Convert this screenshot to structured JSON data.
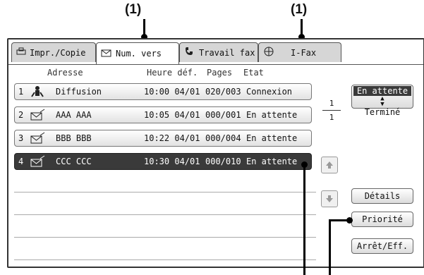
{
  "callouts": {
    "left": "(1)",
    "right": "(1)"
  },
  "tabs": [
    {
      "label": "Impr./Copie",
      "icon": "printer-icon"
    },
    {
      "label": "Num. vers",
      "icon": "envelope-icon"
    },
    {
      "label": "Travail fax",
      "icon": "phone-icon"
    },
    {
      "label": "I-Fax",
      "icon": "globe-phone-icon"
    }
  ],
  "columns": {
    "address": "Adresse",
    "time": "Heure déf.",
    "pages": "Pages",
    "status": "Etat"
  },
  "rows": [
    {
      "num": "1",
      "icon": "broadcast-icon",
      "address": "Diffusion",
      "time": "10:00 04/01",
      "pages": "020/003",
      "status": "Connexion"
    },
    {
      "num": "2",
      "icon": "envelope-send-icon",
      "address": "AAA AAA",
      "time": "10:05 04/01",
      "pages": "000/001",
      "status": "En attente"
    },
    {
      "num": "3",
      "icon": "envelope-send-icon",
      "address": "BBB BBB",
      "time": "10:22 04/01",
      "pages": "000/004",
      "status": "En attente"
    },
    {
      "num": "4",
      "icon": "envelope-send-icon",
      "address": "CCC CCC",
      "time": "10:30 04/01",
      "pages": "000/010",
      "status": "En attente"
    }
  ],
  "page_indicator": {
    "current": "1",
    "total": "1"
  },
  "toggle": {
    "top": "En attente",
    "bottom": "Terminé"
  },
  "buttons": {
    "details": "Détails",
    "priority": "Priorité",
    "stop": "Arrêt/Eff."
  }
}
